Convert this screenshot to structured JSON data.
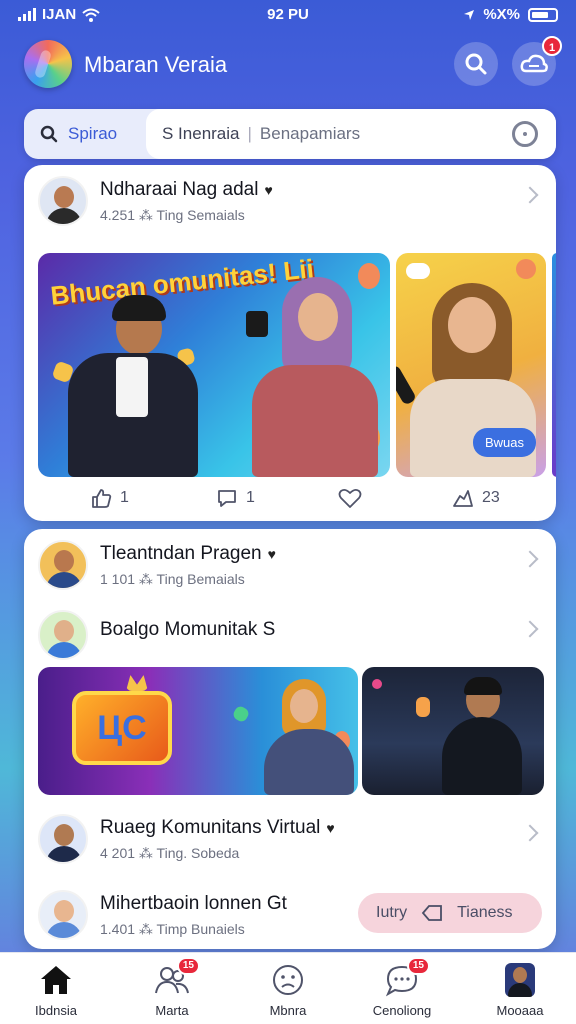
{
  "status_bar": {
    "carrier": "IJAN",
    "time": "92 PU",
    "battery": "%X%"
  },
  "header": {
    "title": "Mbaran Veraia",
    "notif_badge": "1"
  },
  "search": {
    "tab_label": "Spirao",
    "query_left": "S Inenraia",
    "query_right": "Benapamiars"
  },
  "post_1": {
    "title": "Ndharaai Nag adal",
    "meta": "4.251  ⁂ Ting  Semaials",
    "promo_text": "Bhucan omunitas! Lii",
    "tag": "Bwuas",
    "actions": {
      "like_count": "1",
      "comment_count": "1",
      "share_count": "23"
    }
  },
  "list": [
    {
      "title": "Tleantndan Pragen",
      "meta": "1 101  ⁂ Ting  Bemaials"
    },
    {
      "title": "Boalgo Momunitak S",
      "meta": ""
    },
    {
      "title": "Ruaeg Komunitans Virtual",
      "meta": "4 201  ⁂ Ting.  Sobeda"
    },
    {
      "title": "Mihertbaoin lonnen Gt",
      "meta": "1.401  ⁂ Timp  Bunaiels"
    }
  ],
  "media_2_logo": "ЦC",
  "try_button": {
    "left": "Iutry",
    "right": "Tianess"
  },
  "nav": [
    {
      "label": "Ibdnsia",
      "icon": "home-icon",
      "badge": ""
    },
    {
      "label": "Marta",
      "icon": "people-icon",
      "badge": "15"
    },
    {
      "label": "Mbnra",
      "icon": "face-icon",
      "badge": ""
    },
    {
      "label": "Cenoliong",
      "icon": "chat-icon",
      "badge": "15"
    },
    {
      "label": "Mooaaa",
      "icon": "profile-avatar-icon",
      "badge": ""
    }
  ],
  "colors": {
    "accent": "#3b5bd6",
    "badge": "#e8283b",
    "tag": "#3b6fe0"
  }
}
